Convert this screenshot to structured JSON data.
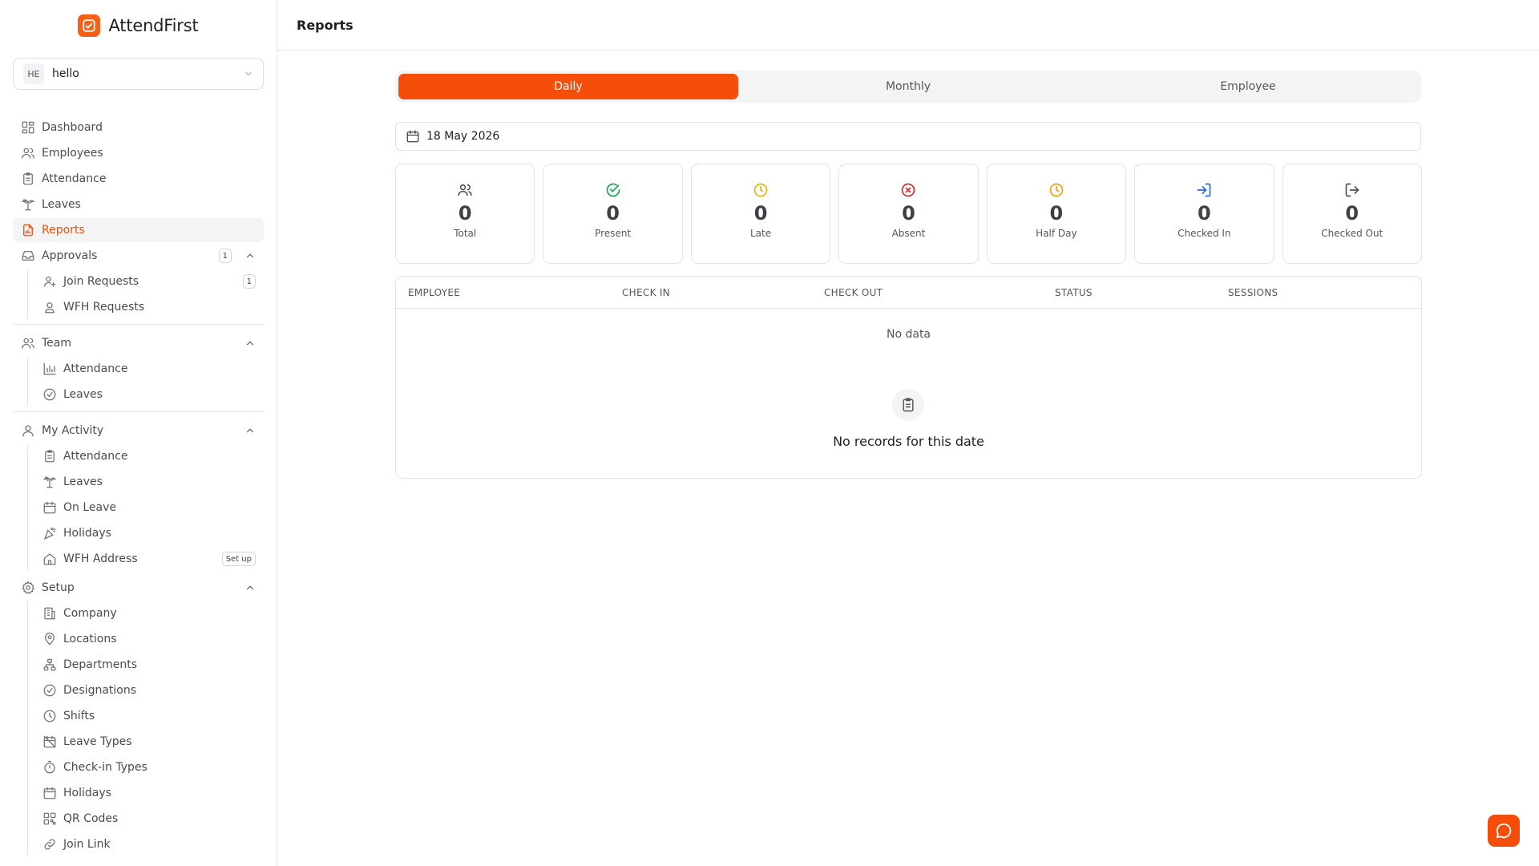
{
  "app": {
    "name": "AttendFirst",
    "brand_color": "#f44e0a"
  },
  "workspace": {
    "initials": "HE",
    "name": "hello"
  },
  "sidebar": {
    "items": [
      {
        "label": "Dashboard"
      },
      {
        "label": "Employees"
      },
      {
        "label": "Attendance"
      },
      {
        "label": "Leaves"
      },
      {
        "label": "Reports"
      }
    ],
    "approvals": {
      "label": "Approvals",
      "badge": "1",
      "items": [
        {
          "label": "Join Requests",
          "badge": "1"
        },
        {
          "label": "WFH Requests"
        }
      ]
    },
    "team": {
      "label": "Team",
      "items": [
        {
          "label": "Attendance"
        },
        {
          "label": "Leaves"
        }
      ]
    },
    "my_activity": {
      "label": "My Activity",
      "items": [
        {
          "label": "Attendance"
        },
        {
          "label": "Leaves"
        },
        {
          "label": "On Leave"
        },
        {
          "label": "Holidays"
        },
        {
          "label": "WFH Address",
          "badge": "Set up"
        }
      ]
    },
    "setup": {
      "label": "Setup",
      "items": [
        {
          "label": "Company"
        },
        {
          "label": "Locations"
        },
        {
          "label": "Departments"
        },
        {
          "label": "Designations"
        },
        {
          "label": "Shifts"
        },
        {
          "label": "Leave Types"
        },
        {
          "label": "Check-in Types"
        },
        {
          "label": "Holidays"
        },
        {
          "label": "QR Codes"
        },
        {
          "label": "Join Link"
        }
      ]
    }
  },
  "header": {
    "title": "Reports"
  },
  "tabs": [
    {
      "label": "Daily"
    },
    {
      "label": "Monthly"
    },
    {
      "label": "Employee"
    }
  ],
  "date_filter": {
    "value": "18 May 2026"
  },
  "stats": [
    {
      "value": "0",
      "label": "Total"
    },
    {
      "value": "0",
      "label": "Present"
    },
    {
      "value": "0",
      "label": "Late"
    },
    {
      "value": "0",
      "label": "Absent"
    },
    {
      "value": "0",
      "label": "Half Day"
    },
    {
      "value": "0",
      "label": "Checked In"
    },
    {
      "value": "0",
      "label": "Checked Out"
    }
  ],
  "table": {
    "columns": [
      "EMPLOYEE",
      "CHECK IN",
      "CHECK OUT",
      "STATUS",
      "SESSIONS"
    ],
    "no_data_text": "No data",
    "empty_message": "No records for this date"
  }
}
